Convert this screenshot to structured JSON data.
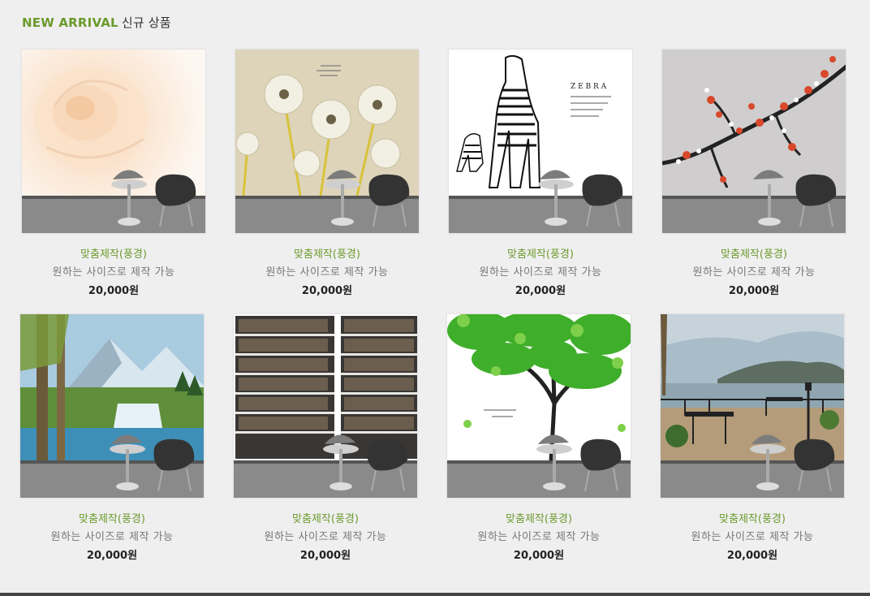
{
  "section": {
    "title_en": "NEW ARRIVAL",
    "title_ko": "신규 상품"
  },
  "products": [
    {
      "name": "맞춤제작(풍경)",
      "desc": "원하는 사이즈로 제작 가능",
      "price": "20,000원",
      "image": "rose-wallpaper"
    },
    {
      "name": "맞춤제작(풍경)",
      "desc": "원하는 사이즈로 제작 가능",
      "price": "20,000원",
      "image": "dandelion-wallpaper"
    },
    {
      "name": "맞춤제작(풍경)",
      "desc": "원하는 사이즈로 제작 가능",
      "price": "20,000원",
      "image": "zebra-wallpaper"
    },
    {
      "name": "맞춤제작(풍경)",
      "desc": "원하는 사이즈로 제작 가능",
      "price": "20,000원",
      "image": "plum-blossom-wallpaper"
    },
    {
      "name": "맞춤제작(풍경)",
      "desc": "원하는 사이즈로 제작 가능",
      "price": "20,000원",
      "image": "mountain-waterfall-wallpaper"
    },
    {
      "name": "맞춤제작(풍경)",
      "desc": "원하는 사이즈로 제작 가능",
      "price": "20,000원",
      "image": "bookshelf-wallpaper"
    },
    {
      "name": "맞춤제작(풍경)",
      "desc": "원하는 사이즈로 제작 가능",
      "price": "20,000원",
      "image": "green-tree-wallpaper"
    },
    {
      "name": "맞춤제작(풍경)",
      "desc": "원하는 사이즈로 제작 가능",
      "price": "20,000원",
      "image": "lake-terrace-wallpaper"
    }
  ]
}
